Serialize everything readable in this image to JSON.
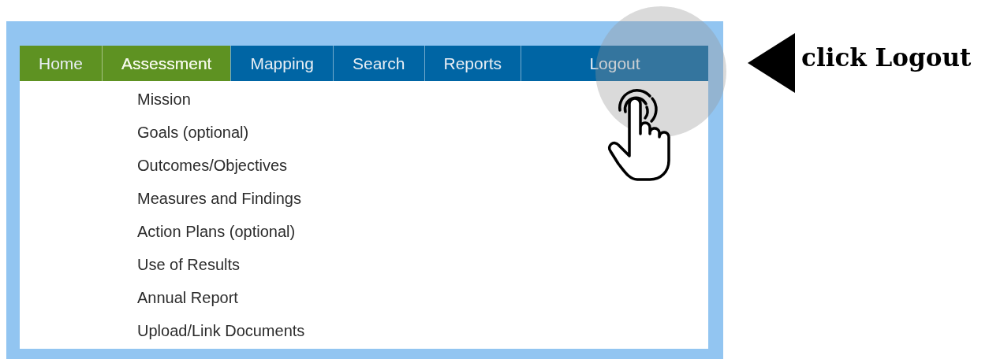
{
  "nav": {
    "tabs": [
      {
        "label": "Home",
        "selected": false,
        "color": "#5e9222"
      },
      {
        "label": "Assessment",
        "selected": true,
        "color": "#5e9222"
      },
      {
        "label": "Mapping",
        "selected": false,
        "color": "#0065a4"
      },
      {
        "label": "Search",
        "selected": false,
        "color": "#0065a4"
      },
      {
        "label": "Reports",
        "selected": false,
        "color": "#0065a4"
      },
      {
        "label": "Logout",
        "selected": false,
        "color": "#0065a4"
      }
    ]
  },
  "submenu": {
    "items": [
      "Mission",
      "Goals (optional)",
      "Outcomes/Objectives",
      "Measures and Findings",
      "Action Plans (optional)",
      "Use of Results",
      "Annual Report",
      "Upload/Link Documents"
    ]
  },
  "callout": {
    "text": "click Logout"
  }
}
